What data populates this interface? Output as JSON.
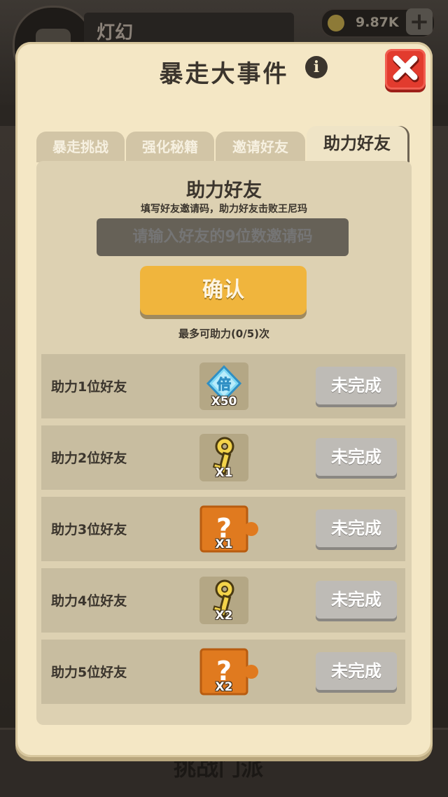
{
  "background": {
    "player_name": "灯幻",
    "currency_value": "9.87K",
    "currency_plus": "+",
    "bottom_label": "挑战门派"
  },
  "modal": {
    "title": "暴走大事件",
    "info_glyph": "i"
  },
  "tabs": [
    {
      "label": "暴走挑战",
      "active": false
    },
    {
      "label": "强化秘籍",
      "active": false
    },
    {
      "label": "邀请好友",
      "active": false
    },
    {
      "label": "助力好友",
      "active": true
    }
  ],
  "help_friend": {
    "title": "助力好友",
    "description": "填写好友邀请码，助力好友击败王尼玛",
    "input_placeholder": "请输入好友的9位数邀请码",
    "confirm_label": "确认",
    "limit_text": "最多可助力(0/5)次"
  },
  "tasks": [
    {
      "label": "助力1位好友",
      "reward_icon": "diamond-multiplier-icon",
      "reward_glyph": "倍",
      "reward_qty": "X50",
      "status": "未完成"
    },
    {
      "label": "助力2位好友",
      "reward_icon": "gold-key-icon",
      "reward_qty": "X1",
      "status": "未完成"
    },
    {
      "label": "助力3位好友",
      "reward_icon": "mystery-puzzle-icon",
      "reward_glyph": "?",
      "reward_qty": "X1",
      "status": "未完成"
    },
    {
      "label": "助力4位好友",
      "reward_icon": "gold-key-icon",
      "reward_qty": "X2",
      "status": "未完成"
    },
    {
      "label": "助力5位好友",
      "reward_icon": "mystery-puzzle-icon",
      "reward_glyph": "?",
      "reward_qty": "X2",
      "status": "未完成"
    }
  ],
  "colors": {
    "modal_bg": "#f4e7c5",
    "confirm_button": "#f0b53d",
    "close_button": "#e23b2e",
    "incomplete_button": "#bebbb6",
    "puzzle_orange": "#e07a1f"
  }
}
